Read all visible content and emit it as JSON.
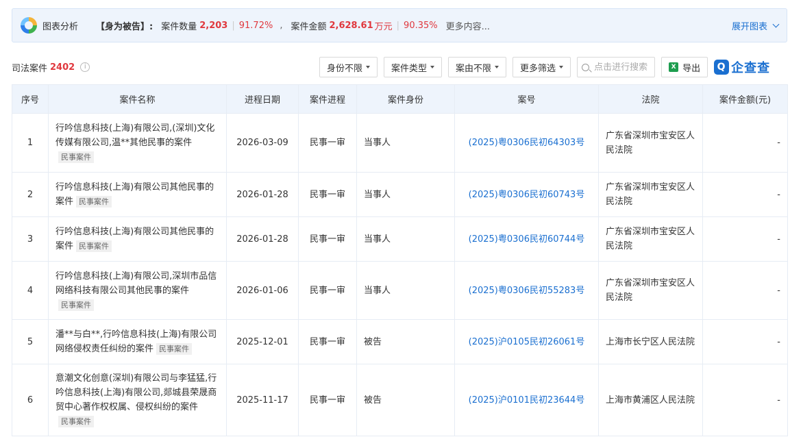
{
  "analysis": {
    "label": "图表分析",
    "role": "【身为被告】:",
    "count_label": "案件数量",
    "count_value": "2,203",
    "count_pct": "91.72%",
    "comma": ",",
    "amount_label": "案件金额",
    "amount_value": "2,628.61",
    "amount_unit": "万元",
    "amount_pct": "90.35%",
    "more": "更多内容...",
    "expand": "展开图表"
  },
  "toolbar": {
    "title": "司法案件",
    "count": "2402",
    "filters": [
      "身份不限",
      "案件类型",
      "案由不限",
      "更多筛选"
    ],
    "search_placeholder": "点击进行搜索",
    "export": "导出",
    "brand": "企查查"
  },
  "table": {
    "headers": [
      "序号",
      "案件名称",
      "进程日期",
      "案件进程",
      "案件身份",
      "案号",
      "法院",
      "案件金额(元)"
    ],
    "rows": [
      {
        "no": "1",
        "name": "行吟信息科技(上海)有限公司,(深圳)文化传媒有限公司,温**其他民事的案件",
        "tag": "民事案件",
        "date": "2026-03-09",
        "stage": "民事一审",
        "role": "当事人",
        "case_no": "(2025)粤0306民初64303号",
        "court": "广东省深圳市宝安区人民法院",
        "amount": "-"
      },
      {
        "no": "2",
        "name": "行吟信息科技(上海)有限公司其他民事的案件",
        "tag": "民事案件",
        "date": "2026-01-28",
        "stage": "民事一审",
        "role": "当事人",
        "case_no": "(2025)粤0306民初60743号",
        "court": "广东省深圳市宝安区人民法院",
        "amount": "-"
      },
      {
        "no": "3",
        "name": "行吟信息科技(上海)有限公司其他民事的案件",
        "tag": "民事案件",
        "date": "2026-01-28",
        "stage": "民事一审",
        "role": "当事人",
        "case_no": "(2025)粤0306民初60744号",
        "court": "广东省深圳市宝安区人民法院",
        "amount": "-"
      },
      {
        "no": "4",
        "name": "行吟信息科技(上海)有限公司,深圳市品信网络科技有限公司其他民事的案件",
        "tag": "民事案件",
        "date": "2026-01-06",
        "stage": "民事一审",
        "role": "当事人",
        "case_no": "(2025)粤0306民初55283号",
        "court": "广东省深圳市宝安区人民法院",
        "amount": "-"
      },
      {
        "no": "5",
        "name": "潘**与白**,行吟信息科技(上海)有限公司网络侵权责任纠纷的案件",
        "tag": "民事案件",
        "date": "2025-12-01",
        "stage": "民事一审",
        "role": "被告",
        "case_no": "(2025)沪0105民初26061号",
        "court": "上海市长宁区人民法院",
        "amount": "-"
      },
      {
        "no": "6",
        "name": "意潮文化创意(深圳)有限公司与李猛猛,行吟信息科技(上海)有限公司,郯城县荣晟商贸中心著作权权属、侵权纠纷的案件",
        "tag": "民事案件",
        "date": "2025-11-17",
        "stage": "民事一审",
        "role": "被告",
        "case_no": "(2025)沪0101民初23644号",
        "court": "上海市黄浦区人民法院",
        "amount": "-"
      }
    ]
  },
  "colors": {
    "accent": "#1a6fd0",
    "highlight": "#e0383e",
    "header_bg": "#eef4fc"
  }
}
